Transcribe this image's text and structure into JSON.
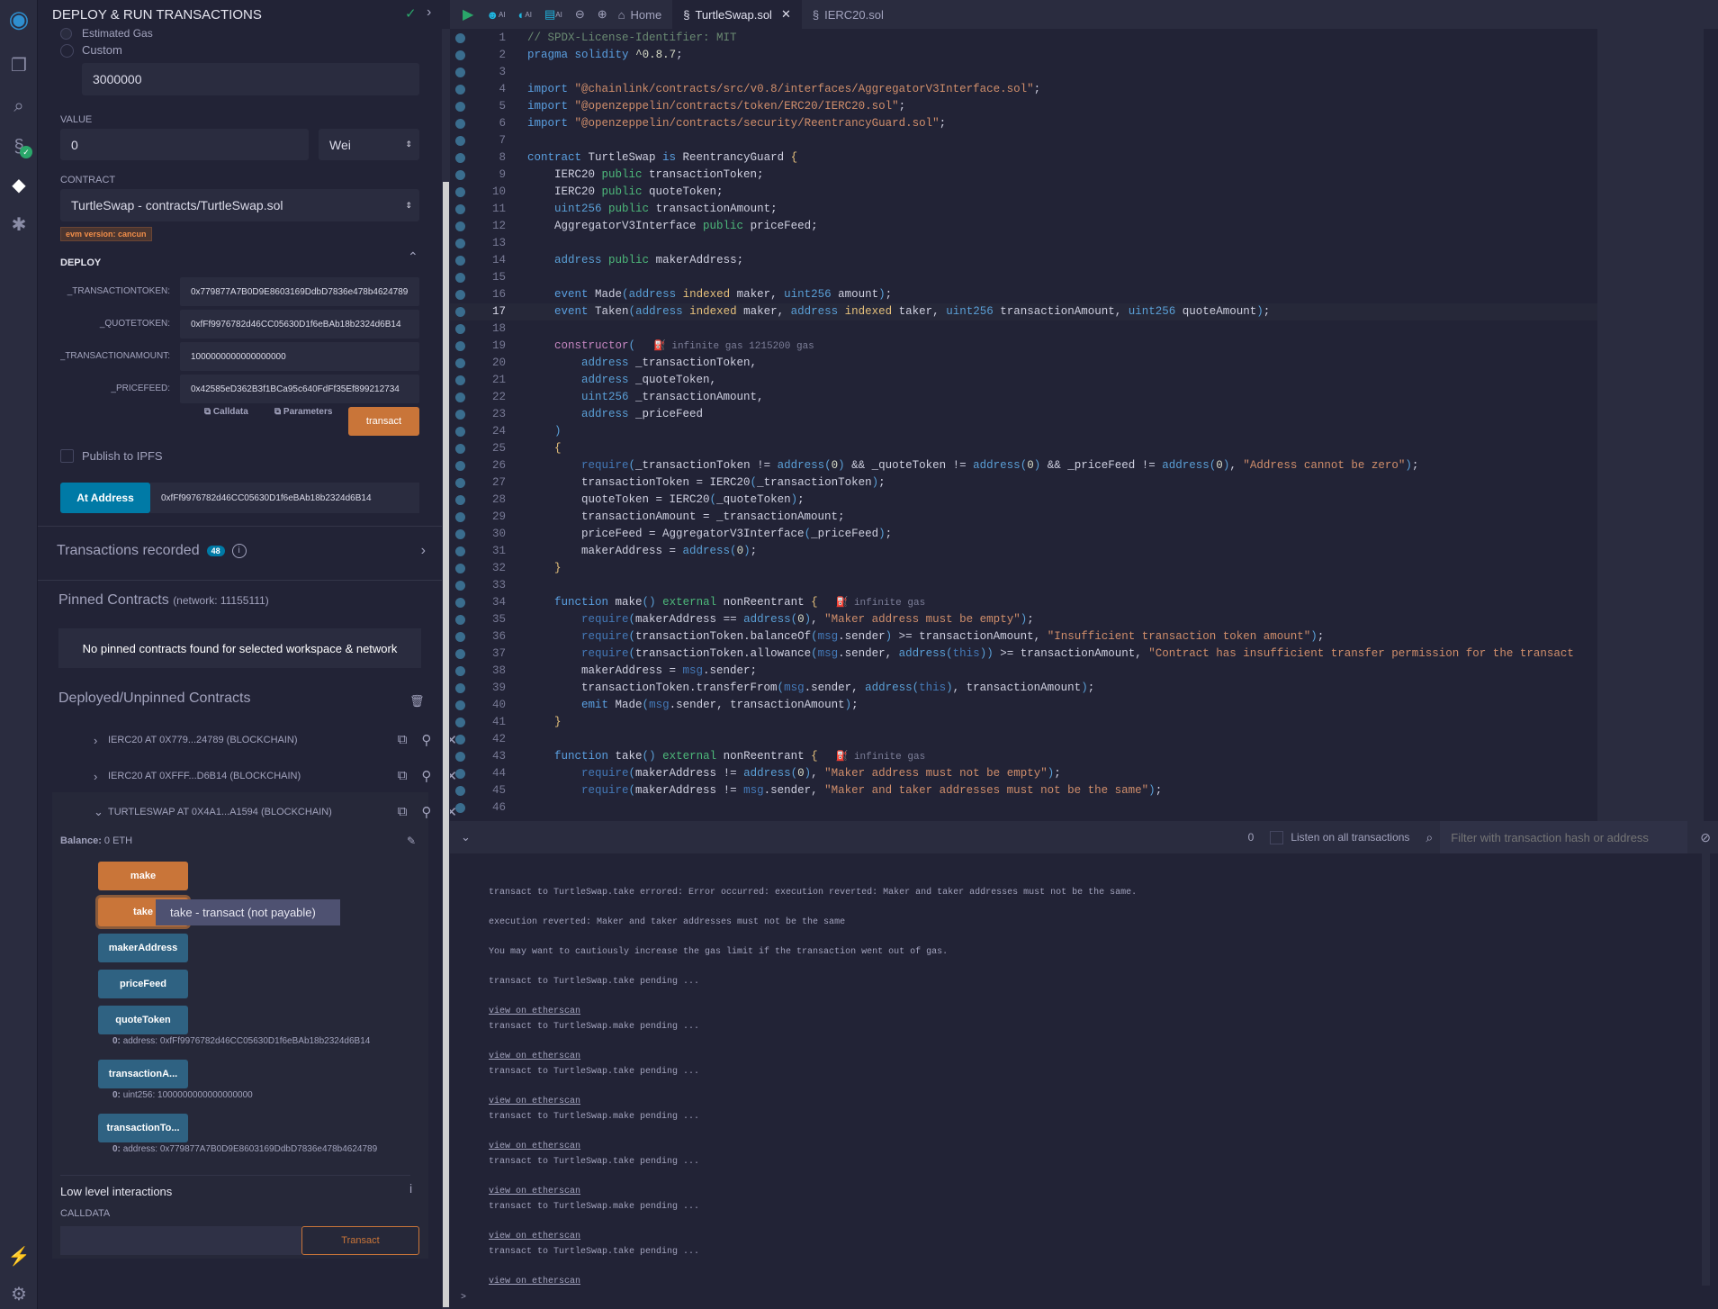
{
  "colors": {
    "accent_orange": "#c97539",
    "button_blue": "#2f6282",
    "at_address_blue": "#007aa6",
    "background": "#222336",
    "panel": "#2a2c3f"
  },
  "iconbar": {
    "icons": [
      "remix-logo-icon",
      "file-explorer-icon",
      "search-icon",
      "solidity-compiler-icon",
      "deploy-run-icon",
      "debugger-icon",
      "plugin-manager-icon",
      "settings-icon"
    ]
  },
  "panel": {
    "title": "DEPLOY & RUN TRANSACTIONS",
    "gas": {
      "estimated_label": "Estimated Gas",
      "custom_label": "Custom",
      "custom_value": "3000000"
    },
    "value": {
      "label": "VALUE",
      "amount": "0",
      "unit": "Wei"
    },
    "contract": {
      "label": "CONTRACT",
      "selected": "TurtleSwap - contracts/TurtleSwap.sol",
      "evm_badge": "evm version: cancun"
    },
    "deploy": {
      "title": "DEPLOY",
      "params": [
        {
          "label": "_TRANSACTIONTOKEN:",
          "value": "0x779877A7B0D9E8603169DdbD7836e478b4624789"
        },
        {
          "label": "_QUOTETOKEN:",
          "value": "0xfFf9976782d46CC05630D1f6eBAb18b2324d6B14"
        },
        {
          "label": "_TRANSACTIONAMOUNT:",
          "value": "1000000000000000000"
        },
        {
          "label": "_PRICEFEED:",
          "value": "0x42585eD362B3f1BCa95c640FdFf35Ef899212734"
        }
      ],
      "calldata_label": "Calldata",
      "parameters_label": "Parameters",
      "transact_label": "transact"
    },
    "publish_ipfs_label": "Publish to IPFS",
    "at_address": {
      "button": "At Address",
      "value": "0xfFf9976782d46CC05630D1f6eBAb18b2324d6B14"
    },
    "transactions_recorded": {
      "label": "Transactions recorded",
      "count": "48"
    },
    "pinned": {
      "title": "Pinned Contracts",
      "network": "(network: 11155111)",
      "empty_text": "No pinned contracts found for selected workspace & network"
    },
    "deployed": {
      "title": "Deployed/Unpinned Contracts",
      "contracts": [
        {
          "name": "IERC20 AT 0X779...24789 (BLOCKCHAIN)",
          "expanded": false
        },
        {
          "name": "IERC20 AT 0XFFF...D6B14 (BLOCKCHAIN)",
          "expanded": false
        },
        {
          "name": "TURTLESWAP AT 0X4A1...A1594 (BLOCKCHAIN)",
          "expanded": true
        }
      ],
      "balance_label": "Balance:",
      "balance_value": "0 ETH",
      "functions": [
        {
          "label": "make",
          "kind": "transact"
        },
        {
          "label": "take",
          "kind": "transact"
        },
        {
          "label": "makerAddress",
          "kind": "call"
        },
        {
          "label": "priceFeed",
          "kind": "call"
        },
        {
          "label": "quoteToken",
          "kind": "call",
          "output": "address: 0xfFf9976782d46CC05630D1f6eBAb18b2324d6B14"
        },
        {
          "label": "transactionA...",
          "kind": "call",
          "output": "uint256: 1000000000000000000"
        },
        {
          "label": "transactionTo...",
          "kind": "call",
          "output": "address: 0x779877A7B0D9E8603169DdbD7836e478b4624789"
        }
      ],
      "output_index": "0:",
      "tooltip": "take - transact (not payable)",
      "low_level": {
        "title": "Low level interactions",
        "calldata_label": "CALLDATA",
        "transact_label": "Transact"
      }
    }
  },
  "toolbar": {
    "home_label": "Home",
    "ai": "AI",
    "tabs": [
      {
        "label": "TurtleSwap.sol",
        "active": true
      },
      {
        "label": "IERC20.sol",
        "active": false
      }
    ]
  },
  "editor": {
    "current_line": 17,
    "lines": [
      "// SPDX-License-Identifier: MIT",
      "pragma solidity ^0.8.7;",
      "",
      "import \"@chainlink/contracts/src/v0.8/interfaces/AggregatorV3Interface.sol\";",
      "import \"@openzeppelin/contracts/token/ERC20/IERC20.sol\";",
      "import \"@openzeppelin/contracts/security/ReentrancyGuard.sol\";",
      "",
      "contract TurtleSwap is ReentrancyGuard {",
      "    IERC20 public transactionToken;",
      "    IERC20 public quoteToken;",
      "    uint256 public transactionAmount;",
      "    AggregatorV3Interface public priceFeed;",
      "",
      "    address public makerAddress;",
      "",
      "    event Made(address indexed maker, uint256 amount);",
      "    event Taken(address indexed maker, address indexed taker, uint256 transactionAmount, uint256 quoteAmount);",
      "",
      "    constructor(",
      "        address _transactionToken,",
      "        address _quoteToken,",
      "        uint256 _transactionAmount,",
      "        address _priceFeed",
      "    )",
      "    {",
      "        require(_transactionToken != address(0) && _quoteToken != address(0) && _priceFeed != address(0), \"Address cannot be zero\");",
      "        transactionToken = IERC20(_transactionToken);",
      "        quoteToken = IERC20(_quoteToken);",
      "        transactionAmount = _transactionAmount;",
      "        priceFeed = AggregatorV3Interface(_priceFeed);",
      "        makerAddress = address(0);",
      "    }",
      "",
      "    function make() external nonReentrant {",
      "        require(makerAddress == address(0), \"Maker address must be empty\");",
      "        require(transactionToken.balanceOf(msg.sender) >= transactionAmount, \"Insufficient transaction token amount\");",
      "        require(transactionToken.allowance(msg.sender, address(this)) >= transactionAmount, \"Contract has insufficient transfer permission for the transact",
      "        makerAddress = msg.sender;",
      "        transactionToken.transferFrom(msg.sender, address(this), transactionAmount);",
      "        emit Made(msg.sender, transactionAmount);",
      "    }",
      "",
      "    function take() external nonReentrant {",
      "        require(makerAddress != address(0), \"Maker address must not be empty\");",
      "        require(makerAddress != msg.sender, \"Maker and taker addresses must not be the same\");",
      ""
    ],
    "gas_hints": {
      "19": "infinite gas 1215200 gas",
      "34": "infinite gas",
      "43": "infinite gas"
    }
  },
  "terminal": {
    "count": "0",
    "listen_label": "Listen on all transactions",
    "filter_placeholder": "Filter with transaction hash or address",
    "lines": [
      {
        "text": "transact to TurtleSwap.take errored: Error occurred: execution reverted: Maker and taker addresses must not be the same.",
        "link": false
      },
      {
        "text": "execution reverted: Maker and taker addresses must not be the same",
        "link": false
      },
      {
        "text": "You may want to cautiously increase the gas limit if the transaction went out of gas.",
        "link": false
      },
      {
        "text": "transact to TurtleSwap.take pending ...",
        "link": false
      },
      {
        "text": "view on etherscan",
        "link": true
      },
      {
        "text": "transact to TurtleSwap.make pending ...",
        "link": false
      },
      {
        "text": "view on etherscan",
        "link": true
      },
      {
        "text": "transact to TurtleSwap.take pending ...",
        "link": false
      },
      {
        "text": "view on etherscan",
        "link": true
      },
      {
        "text": "transact to TurtleSwap.make pending ...",
        "link": false
      },
      {
        "text": "view on etherscan",
        "link": true
      },
      {
        "text": "transact to TurtleSwap.take pending ...",
        "link": false
      },
      {
        "text": "view on etherscan",
        "link": true
      },
      {
        "text": "transact to TurtleSwap.make pending ...",
        "link": false
      },
      {
        "text": "view on etherscan",
        "link": true
      },
      {
        "text": "transact to TurtleSwap.take pending ...",
        "link": false
      },
      {
        "text": "view on etherscan",
        "link": true
      }
    ],
    "prompt": ">"
  }
}
